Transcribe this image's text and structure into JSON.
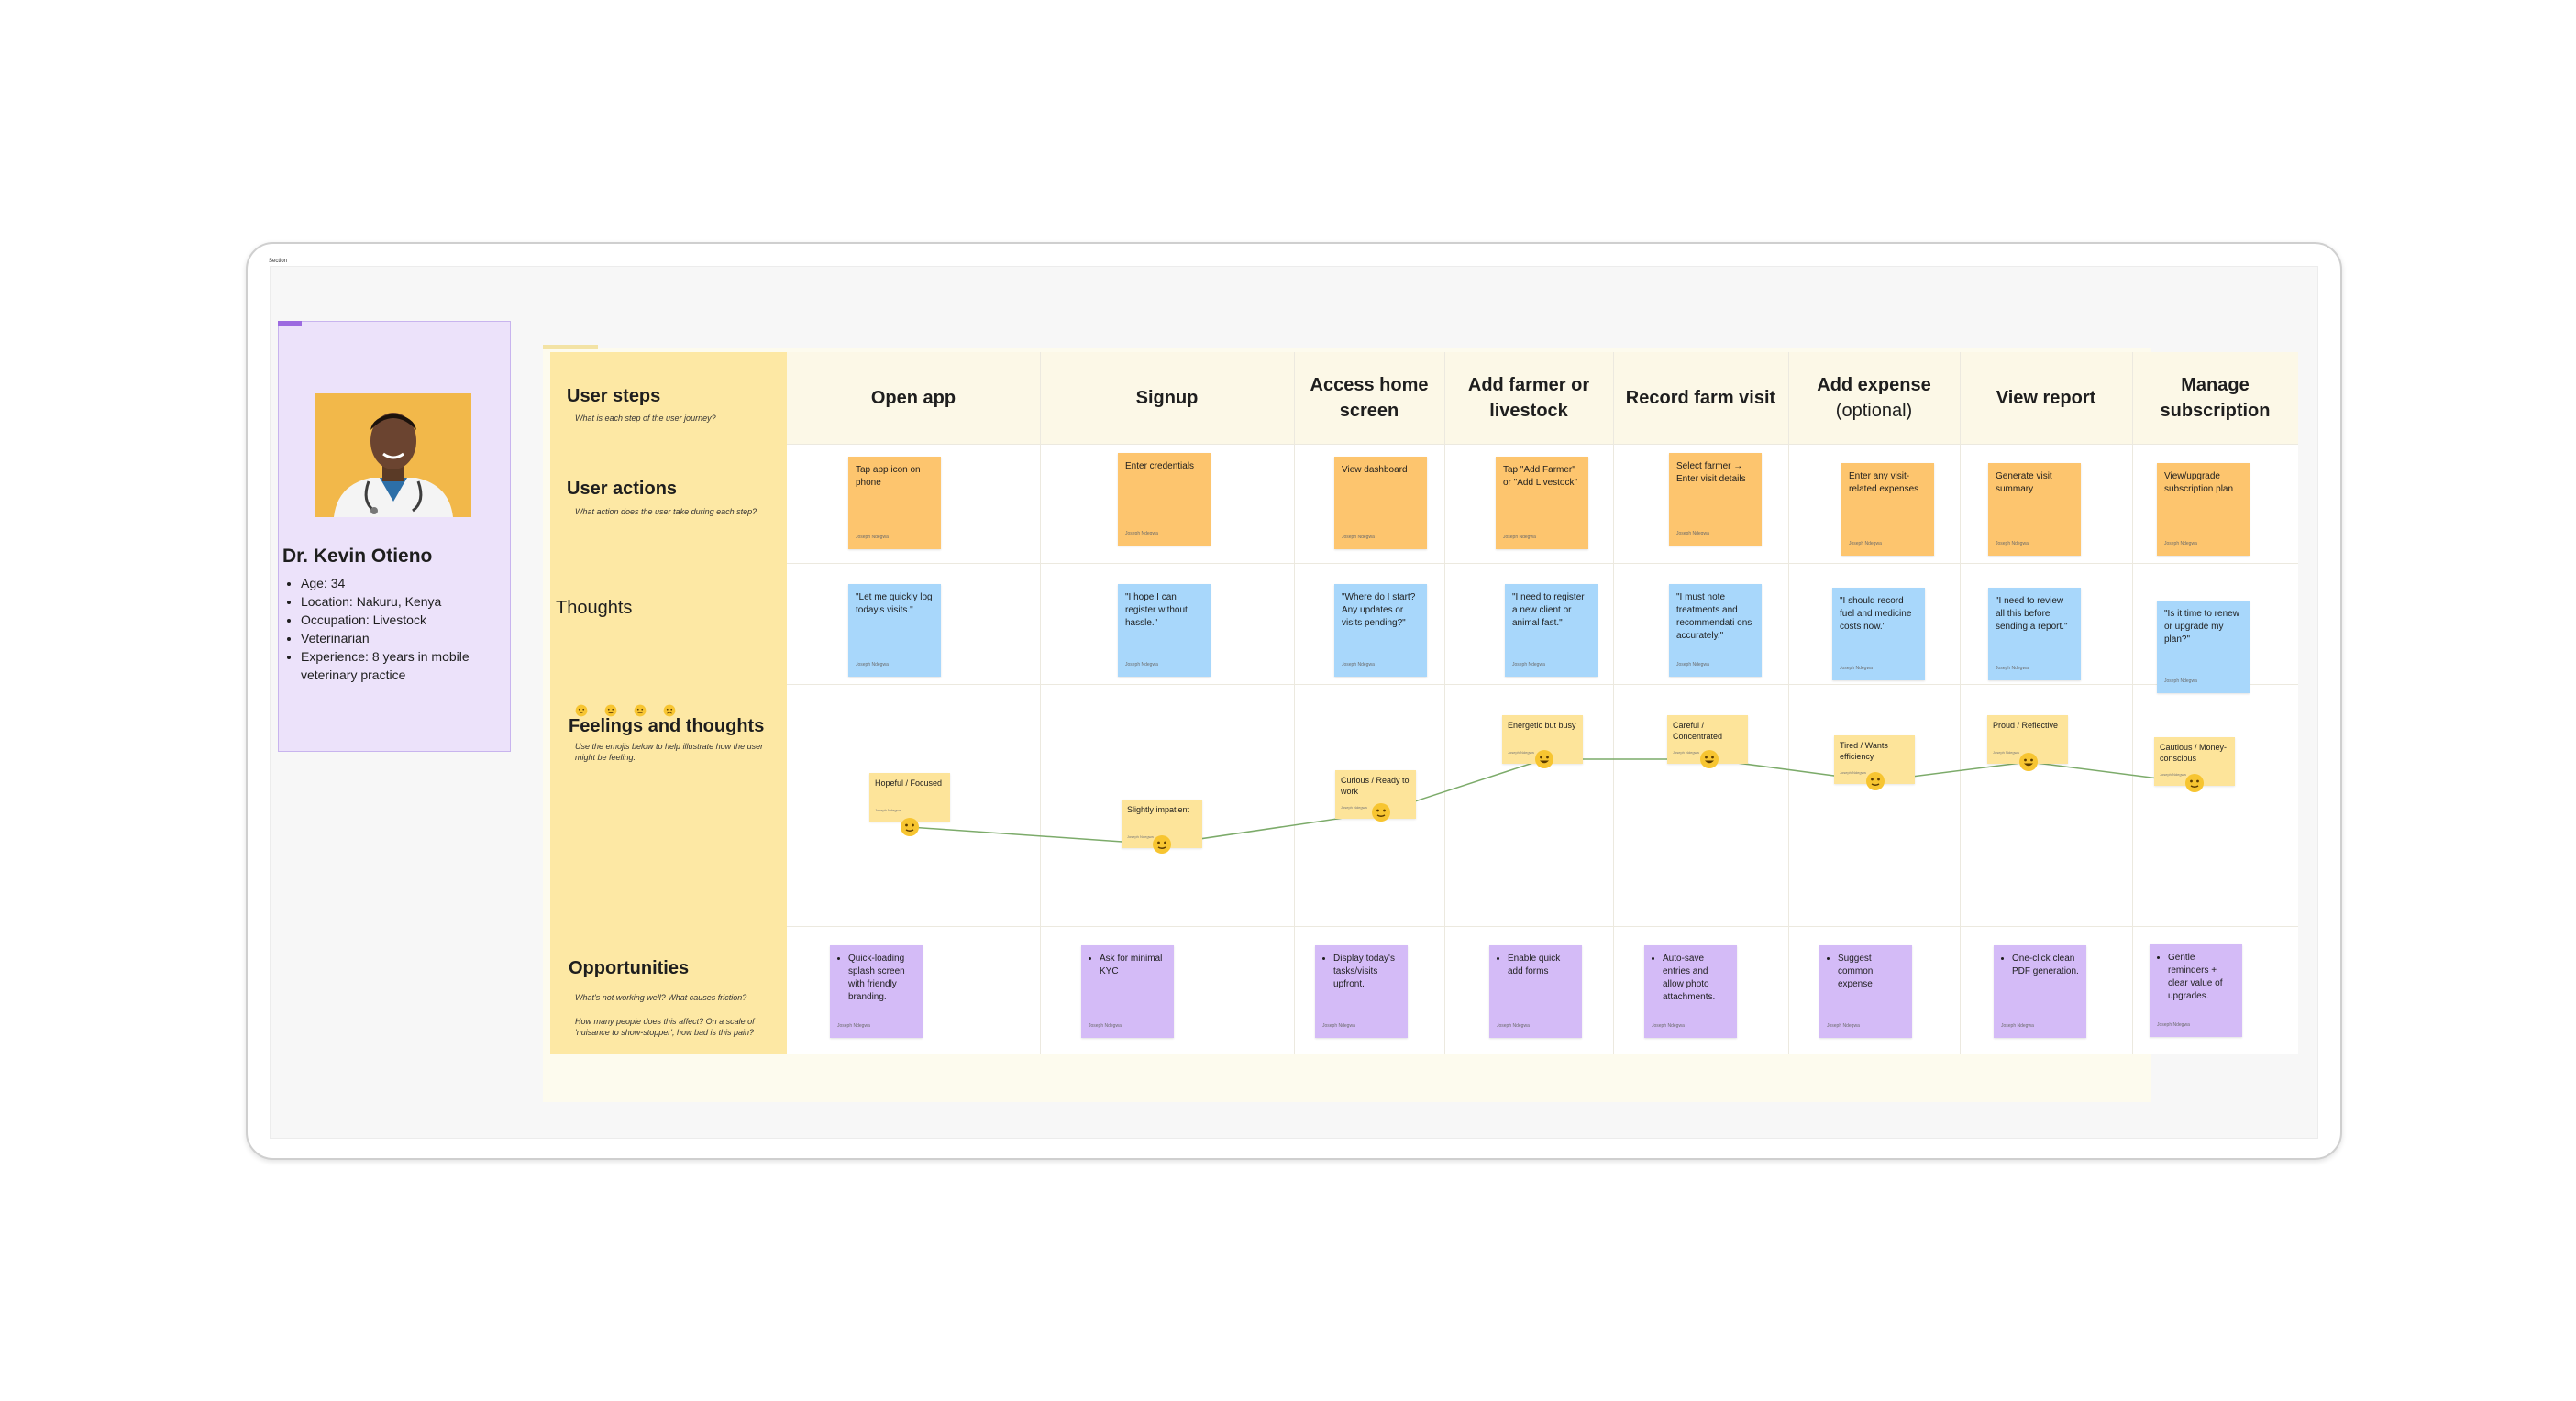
{
  "persona": {
    "name": "Dr. Kevin Otieno",
    "details": [
      "Age: 34",
      "Location: Nakuru, Kenya",
      "Occupation: Livestock",
      "Veterinarian",
      "Experience: 8 years in mobile veterinary practice"
    ]
  },
  "rows": {
    "user_steps": {
      "title": "User steps",
      "sub": "What is each step of the user journey?"
    },
    "user_actions": {
      "title": "User actions",
      "sub": "What action does the user take during each step?"
    },
    "thoughts": {
      "title": "Thoughts"
    },
    "feelings": {
      "title": "Feelings and thoughts",
      "sub": "Use the emojis below to help illustrate how the user might be feeling."
    },
    "opportunities": {
      "title": "Opportunities",
      "sub1": "What's not working well? What causes friction?",
      "sub2": "How many people does this affect? On a scale of 'nuisance to show-stopper', how bad is this pain?"
    }
  },
  "steps": [
    {
      "label": "Open app"
    },
    {
      "label": "Signup"
    },
    {
      "label": "Access home screen"
    },
    {
      "label": "Add farmer or livestock"
    },
    {
      "label": "Record farm visit"
    },
    {
      "label": "Add expense",
      "sub": "(optional)"
    },
    {
      "label": "View report"
    },
    {
      "label": "Manage subscription"
    }
  ],
  "actions": [
    "Tap app icon on phone",
    "Enter credentials",
    "View dashboard",
    "Tap \"Add Farmer\" or \"Add Livestock\"",
    "Select farmer → Enter visit details",
    "Enter any visit-related expenses",
    "Generate visit summary",
    "View/upgrade subscription plan"
  ],
  "thoughts": [
    "\"Let me quickly log today's visits.\"",
    "\"I hope I can register without hassle.\"",
    "\"Where do I start? Any updates or visits pending?\"",
    "\"I need to register a new client or animal fast.\"",
    "\"I must note treatments and recommendati ons accurately.\"",
    "\"I should record fuel and medicine costs now.\"",
    "\"I need to review all this before sending a report.\"",
    "\"Is it time to renew or upgrade my plan?\""
  ],
  "feelings": [
    {
      "label": "Hopeful / Focused",
      "mood": "neutral"
    },
    {
      "label": "Slightly impatient",
      "mood": "neutral"
    },
    {
      "label": "Curious / Ready to work",
      "mood": "neutral"
    },
    {
      "label": "Energetic but busy",
      "mood": "happy"
    },
    {
      "label": "Careful / Concentrated",
      "mood": "happy"
    },
    {
      "label": "Tired / Wants efficiency",
      "mood": "neutral"
    },
    {
      "label": "Proud / Reflective",
      "mood": "happy"
    },
    {
      "label": "Cautious / Money-conscious",
      "mood": "neutral"
    }
  ],
  "opportunities": [
    "Quick-loading splash screen with friendly branding.",
    "Ask for minimal KYC",
    "Display today's tasks/visits upfront.",
    "Enable quick add forms",
    "Auto-save entries and allow photo attachments.",
    "Suggest common expense",
    "One-click clean PDF generation.",
    "Gentle reminders + clear value of upgrades."
  ],
  "sticky_author": "Joseph Ndegwa",
  "colors": {
    "persona_bg": "#ece2fa",
    "label_column": "#fde8a4",
    "action_sticky": "#fdc56e",
    "thought_sticky": "#a8d7fb",
    "opportunity_sticky": "#d4bbf7",
    "feeling_sticky": "#fde49a",
    "curve": "#7cab6a"
  }
}
